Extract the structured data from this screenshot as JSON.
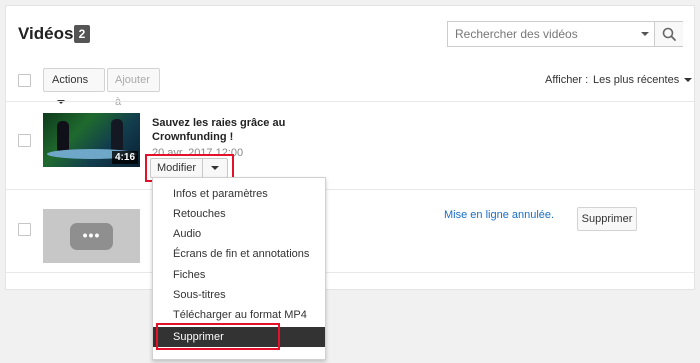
{
  "header": {
    "title": "Vidéos",
    "count": "2",
    "search_placeholder": "Rechercher des vidéos"
  },
  "toolbar": {
    "actions_label": "Actions",
    "add_label": "Ajouter à",
    "show_label": "Afficher :",
    "sort_label": "Les plus récentes"
  },
  "videos": [
    {
      "title": "Sauvez les raies grâce au Crownfunding !",
      "date": "20 avr. 2017 12:00",
      "duration": "4:16",
      "edit_label": "Modifier"
    },
    {
      "status": "Mise en ligne annulée.",
      "delete_label": "Supprimer"
    }
  ],
  "menu": {
    "items": [
      "Infos et paramètres",
      "Retouches",
      "Audio",
      "Écrans de fin et annotations",
      "Fiches",
      "Sous-titres",
      "Télécharger au format MP4",
      "Supprimer"
    ],
    "active_index": 7
  },
  "colors": {
    "highlight_red": "#e5112b",
    "link_blue": "#1a6fc4",
    "active_bg": "#333333"
  }
}
